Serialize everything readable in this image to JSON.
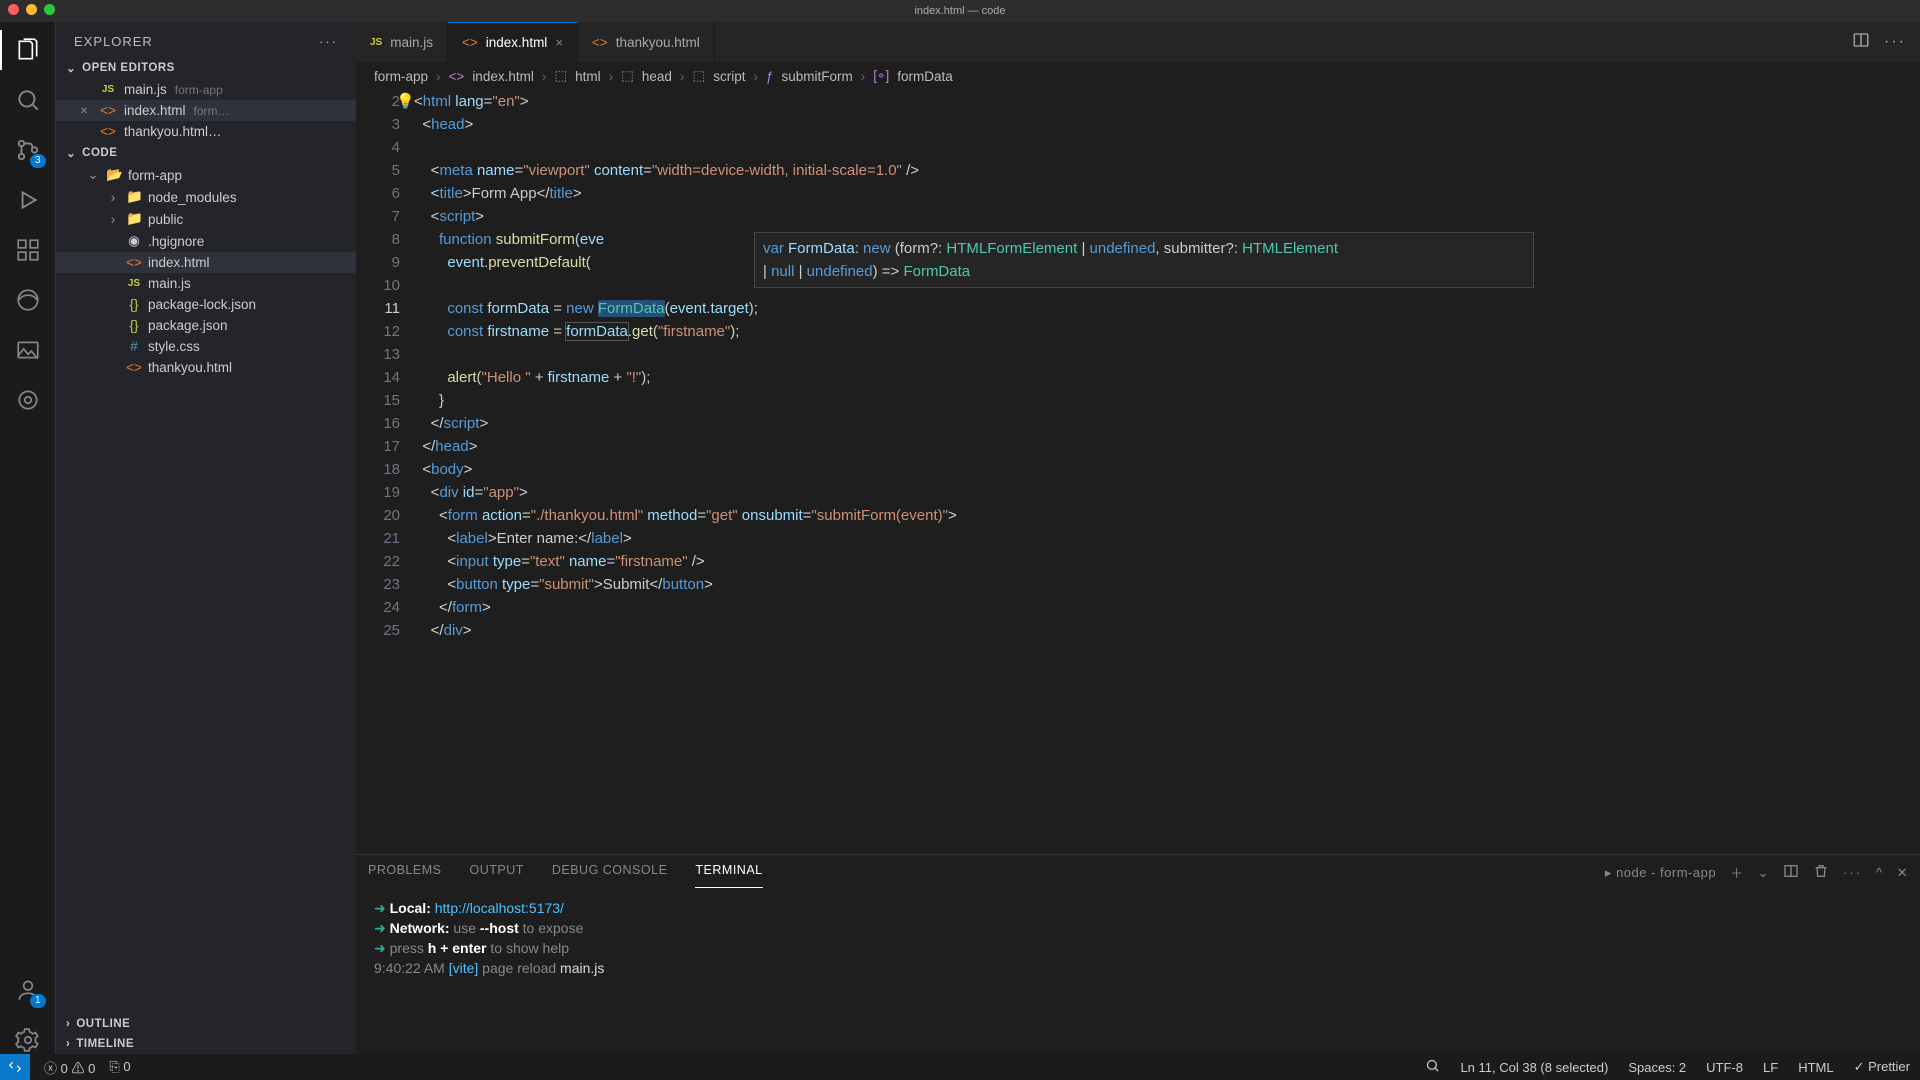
{
  "window": {
    "title": "index.html — code"
  },
  "activitybar": {
    "badges": {
      "scm": "3",
      "accounts": "1"
    }
  },
  "explorer": {
    "title": "EXPLORER",
    "openEditors": "OPEN EDITORS",
    "files": [
      {
        "icon": "JS",
        "name": "main.js",
        "hint": "form-app"
      },
      {
        "icon": "<>",
        "name": "index.html",
        "hint": "form…",
        "mod": true
      },
      {
        "icon": "<>",
        "name": "thankyou.html…",
        "hint": ""
      }
    ],
    "codeSection": "CODE",
    "tree": {
      "root": "form-app",
      "items": [
        {
          "chev": "›",
          "icon": "📁",
          "name": "node_modules",
          "cls": ""
        },
        {
          "chev": "›",
          "icon": "📁",
          "name": "public",
          "cls": ""
        },
        {
          "chev": "",
          "icon": "◉",
          "name": ".hgignore",
          "cls": ""
        },
        {
          "chev": "",
          "icon": "<>",
          "name": "index.html",
          "cls": "ic-html",
          "active": true
        },
        {
          "chev": "",
          "icon": "JS",
          "name": "main.js",
          "cls": "ic-js"
        },
        {
          "chev": "",
          "icon": "{}",
          "name": "package-lock.json",
          "cls": "ic-brace"
        },
        {
          "chev": "",
          "icon": "{}",
          "name": "package.json",
          "cls": "ic-brace"
        },
        {
          "chev": "",
          "icon": "#",
          "name": "style.css",
          "cls": "ic-hash"
        },
        {
          "chev": "",
          "icon": "<>",
          "name": "thankyou.html",
          "cls": "ic-html"
        }
      ]
    },
    "outline": "OUTLINE",
    "timeline": "TIMELINE"
  },
  "tabs": [
    {
      "icon": "JS",
      "label": "main.js",
      "cls": "ic-js"
    },
    {
      "icon": "<>",
      "label": "index.html",
      "cls": "ic-html",
      "active": true,
      "close": "×"
    },
    {
      "icon": "<>",
      "label": "thankyou.html",
      "cls": "ic-html"
    }
  ],
  "breadcrumb": [
    "form-app",
    "index.html",
    "html",
    "head",
    "script",
    "submitForm",
    "formData"
  ],
  "breadcrumb_icons": [
    "",
    "<>",
    "⬚",
    "⬚",
    "⬚",
    "ƒ",
    "[∘]"
  ],
  "code": {
    "first_line": 2,
    "active_line": 11,
    "tooltip": {
      "l1": {
        "p1": "var",
        "p2": " FormData",
        "p3": ": ",
        "p4": "new",
        "p5": " (form?: ",
        "p6": "HTMLFormElement",
        "p7": " | ",
        "p8": "undefined",
        "p9": ", submitter?: ",
        "p10": "HTMLElement"
      },
      "l2": {
        "p1": " | ",
        "p2": "null",
        "p3": " | ",
        "p4": "undefined",
        "p5": ") => ",
        "p6": "FormData"
      }
    }
  },
  "panel": {
    "tabs": [
      "PROBLEMS",
      "OUTPUT",
      "DEBUG CONSOLE",
      "TERMINAL"
    ],
    "active": 3,
    "shell": "node - form-app",
    "term": {
      "l1a": "Local:",
      "l1b": "http://localhost:5173/",
      "l2a": "Network:",
      "l2b": "use ",
      "l2c": "--host",
      "l2d": " to expose",
      "l3a": "press ",
      "l3b": "h + enter",
      "l3c": " to show help",
      "l4a": "9:40:22 AM ",
      "l4b": "[vite]",
      "l4c": " page reload ",
      "l4d": "main.js"
    }
  },
  "statusbar": {
    "errors": "0",
    "warnings": "0",
    "port": "0",
    "cursor": "Ln 11, Col 38 (8 selected)",
    "spaces": "Spaces: 2",
    "enc": "UTF-8",
    "eol": "LF",
    "lang": "HTML",
    "prettier": "Prettier"
  }
}
